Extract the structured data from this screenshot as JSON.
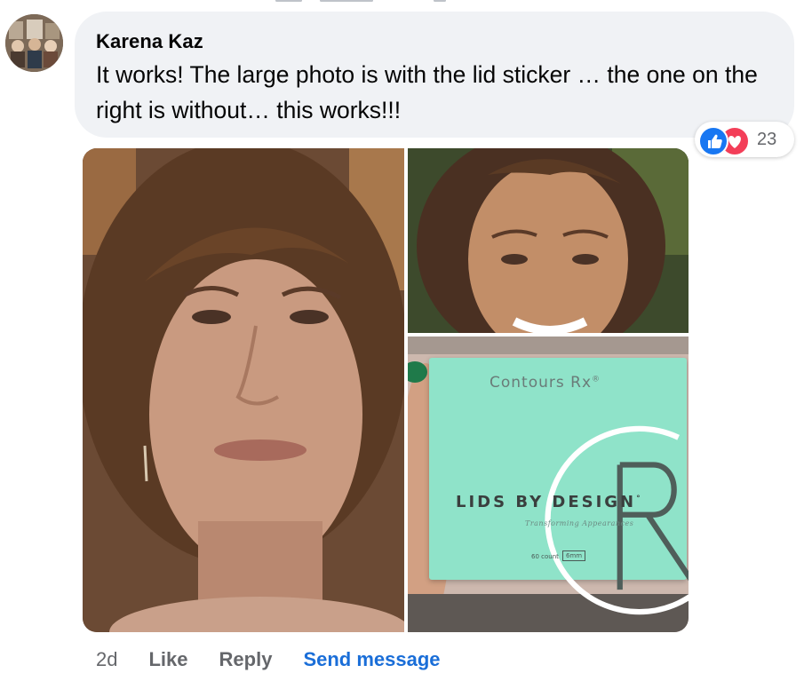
{
  "comment": {
    "author": "Karena Kaz",
    "text": "It works! The large photo is with the lid sticker … the one on the right is without… this works!!!",
    "avatar_icon": "user-avatar",
    "reactions": {
      "types": [
        "like-icon",
        "love-icon"
      ],
      "count": "23",
      "like_color": "#1877f2",
      "love_color": "#f33e58"
    },
    "timestamp": "2d",
    "actions": {
      "like_label": "Like",
      "reply_label": "Reply",
      "send_message_label": "Send message"
    }
  },
  "product_card": {
    "brand": "Contours Rx",
    "brand_mark": "®",
    "product_name": "LIDS BY DESIGN",
    "product_mark": "°",
    "tagline": "Transforming Appearances",
    "count": "60 count",
    "size": "6mm"
  },
  "colors": {
    "bubble_bg": "#f0f2f5",
    "link_blue": "#1a6ed8",
    "secondary_text": "#65676b",
    "card_mint": "#8fe3c9"
  }
}
